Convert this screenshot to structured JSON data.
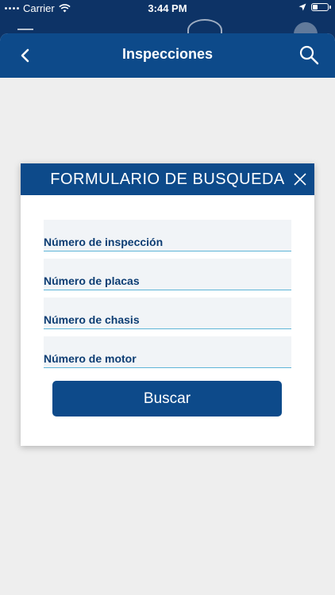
{
  "status_bar": {
    "carrier": "Carrier",
    "time": "3:44 PM"
  },
  "nav": {
    "title": "Inspecciones",
    "back_icon": "chevron-left-icon",
    "search_icon": "search-icon"
  },
  "dialog": {
    "title": "FORMULARIO DE BUSQUEDA",
    "close_icon": "close-icon",
    "fields": [
      {
        "label": "Número de inspección"
      },
      {
        "label": "Número de placas"
      },
      {
        "label": "Número de chasis"
      },
      {
        "label": "Número de motor"
      }
    ],
    "submit_label": "Buscar"
  },
  "colors": {
    "primary": "#0d4a8a",
    "status_bar": "#0d3366",
    "field_background": "#f1f4f7",
    "field_underline": "#5fb5d8",
    "label_text": "#0d3d73",
    "page_background": "#eeeeee"
  }
}
